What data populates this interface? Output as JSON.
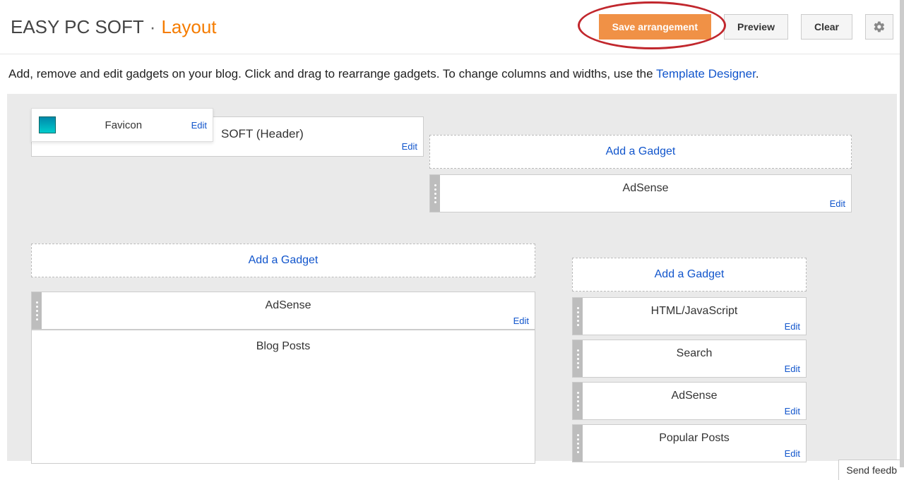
{
  "header": {
    "blog_name": "EASY PC SOFT",
    "separator": "·",
    "section": "Layout",
    "save_label": "Save arrangement",
    "preview_label": "Preview",
    "clear_label": "Clear"
  },
  "instruction": {
    "text_a": "Add, remove and edit gadgets on your blog. Click and drag to rearrange gadgets. To change columns and widths, use the ",
    "link": "Template Designer",
    "period": "."
  },
  "favicon": {
    "label": "Favicon",
    "edit": "Edit"
  },
  "header_widget": {
    "label": "SOFT (Header)",
    "edit": "Edit"
  },
  "top_right": {
    "add": "Add a Gadget",
    "adsense": {
      "label": "AdSense",
      "edit": "Edit"
    }
  },
  "main_left": {
    "add": "Add a Gadget",
    "adsense": {
      "label": "AdSense",
      "edit": "Edit"
    },
    "blog_posts": "Blog Posts"
  },
  "sidebar": {
    "add": "Add a Gadget",
    "items": [
      {
        "label": "HTML/JavaScript",
        "edit": "Edit"
      },
      {
        "label": "Search",
        "edit": "Edit"
      },
      {
        "label": "AdSense",
        "edit": "Edit"
      },
      {
        "label": "Popular Posts",
        "edit": "Edit"
      }
    ]
  },
  "feedback": "Send feedb"
}
